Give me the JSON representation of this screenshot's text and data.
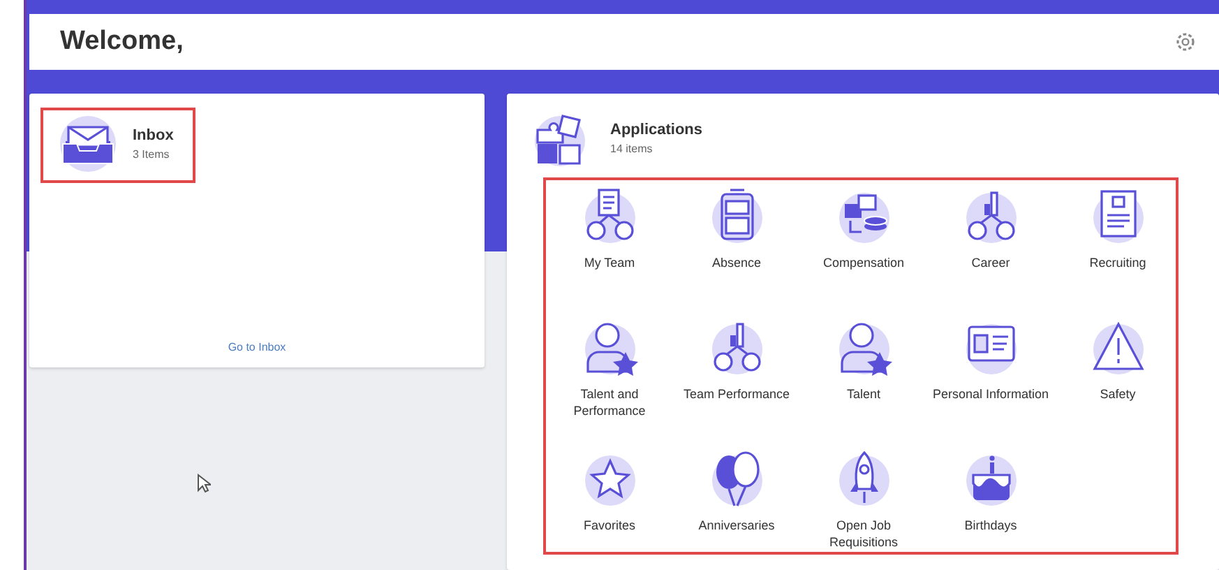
{
  "header": {
    "title": "Welcome,"
  },
  "inbox": {
    "title": "Inbox",
    "count": "3 Items",
    "link": "Go to Inbox",
    "highlighted": true
  },
  "applications": {
    "title": "Applications",
    "count": "14 items",
    "highlighted": true,
    "items": [
      {
        "label": "My Team",
        "kind": "team"
      },
      {
        "label": "Absence",
        "kind": "luggage"
      },
      {
        "label": "Compensation",
        "kind": "coins"
      },
      {
        "label": "Career",
        "kind": "chart"
      },
      {
        "label": "Recruiting",
        "kind": "document"
      },
      {
        "label": "Talent and Performance",
        "kind": "person-star"
      },
      {
        "label": "Team Performance",
        "kind": "chart"
      },
      {
        "label": "Talent",
        "kind": "person-star"
      },
      {
        "label": "Personal Information",
        "kind": "id-card"
      },
      {
        "label": "Safety",
        "kind": "warning"
      },
      {
        "label": "Favorites",
        "kind": "star"
      },
      {
        "label": "Anniversaries",
        "kind": "balloons"
      },
      {
        "label": "Open Job Requisitions",
        "kind": "rocket"
      },
      {
        "label": "Birthdays",
        "kind": "cake"
      }
    ]
  }
}
